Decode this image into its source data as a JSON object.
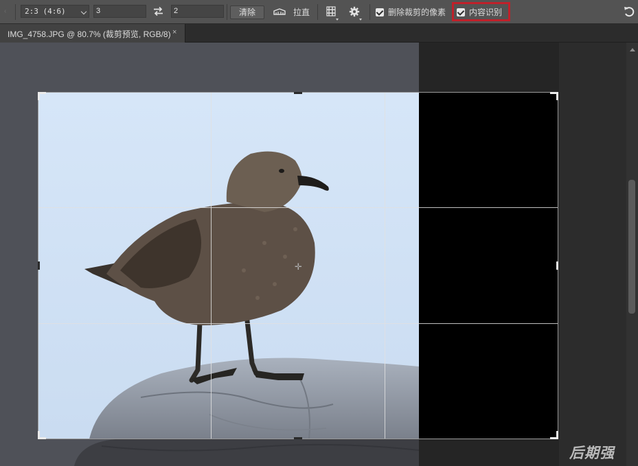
{
  "options_bar": {
    "ratio_value": "2:3 (4:6)",
    "width_value": "3",
    "height_value": "2",
    "clear_label": "清除",
    "straighten_label": "拉直",
    "delete_cropped_label": "删除裁剪的像素",
    "delete_cropped_checked": true,
    "content_aware_label": "内容识别",
    "content_aware_checked": true,
    "highlight_color": "#c0202a"
  },
  "document_tab": {
    "title": "IMG_4758.JPG @ 80.7% (裁剪预览, RGB/8)",
    "close_label": "×"
  },
  "icons": {
    "swap": "swap-arrows-icon",
    "straighten": "straighten-icon",
    "overlay": "grid-overlay-icon",
    "settings": "gear-icon",
    "reset": "undo-icon"
  },
  "watermark": "后期强",
  "colors": {
    "toolbar": "#535353",
    "canvas": "#4f5158",
    "sky": "#d2e3f5",
    "crop_fill": "#000000"
  }
}
